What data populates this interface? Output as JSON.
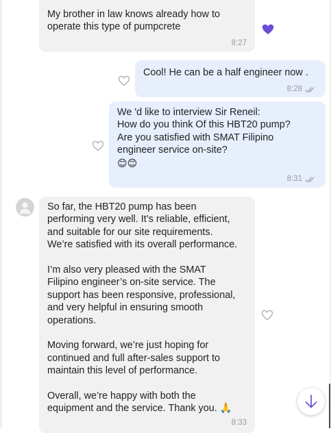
{
  "messages": [
    {
      "id": "m1",
      "direction": "incoming",
      "lines": [
        "My brother in law knows already how to",
        "operate this type of pumpcrete"
      ],
      "time": "8:27",
      "reaction": "purple-heart-icon"
    },
    {
      "id": "m2",
      "direction": "outgoing",
      "lines": [
        "Cool! He can be a half engineer now ."
      ],
      "time": "8:28"
    },
    {
      "id": "m3",
      "direction": "outgoing",
      "lines": [
        "We 'd like to interview Sir Reneil:",
        "How do you think Of this  HBT20 pump?",
        "Are you satisfied with SMAT  Filipino",
        "engineer service on-site?"
      ],
      "emoji": "😊😊",
      "time": "8:31"
    },
    {
      "id": "m4",
      "direction": "incoming",
      "lines": [
        "So far, the HBT20 pump has been",
        "performing very well. It’s reliable, efficient,",
        "and suitable for our site requirements.",
        "We’re satisfied with its overall performance.",
        "",
        "I’m also very pleased with the SMAT",
        "Filipino engineer’s on-site service. The",
        "support has been responsive, professional,",
        "and very helpful in ensuring smooth",
        "operations.",
        "",
        "Moving forward, we’re just hoping for",
        "continued and full after-sales support to",
        "maintain this level of performance.",
        "",
        "Overall, we’re happy with both the",
        "equipment and the service. Thank you. 🙏"
      ],
      "time": "8:33"
    }
  ],
  "icons": {
    "reaction_outline": "heart-outline-icon",
    "read_receipt": "double-check-icon",
    "avatar": "default-user-avatar-icon",
    "scroll": "arrow-down-icon"
  },
  "colors": {
    "incoming_bubble": "#f1f1f1",
    "outgoing_bubble": "#e7effd",
    "accent_purple": "#6b4fd8",
    "scroll_arrow": "#6a54d6"
  }
}
